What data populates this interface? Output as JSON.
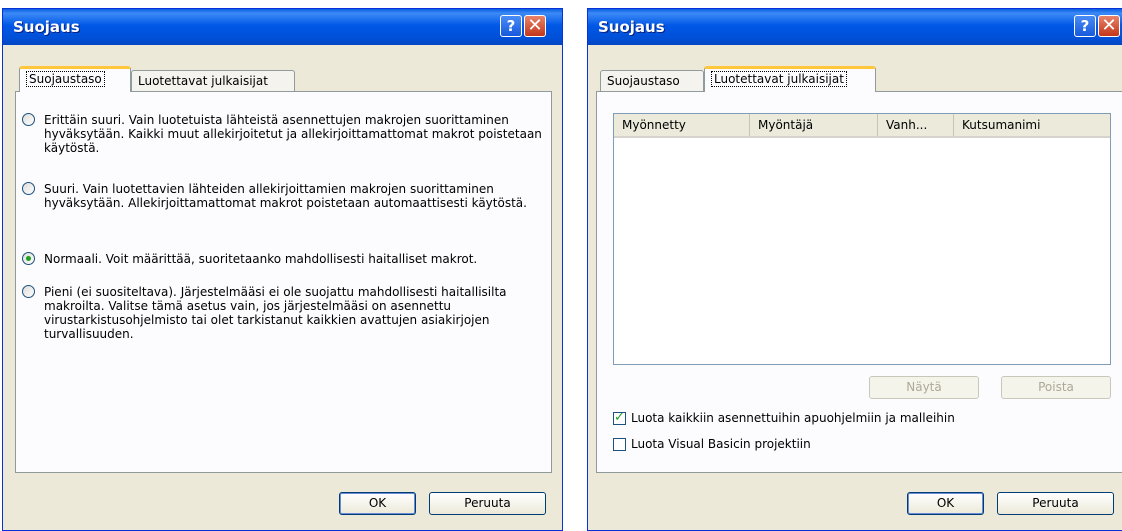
{
  "left_dialog": {
    "title": "Suojaus",
    "help_glyph": "?",
    "close_glyph": "✕",
    "tabs": [
      {
        "label": "Suojaustaso",
        "active": true
      },
      {
        "label": "Luotettavat julkaisijat",
        "active": false
      }
    ],
    "options": [
      {
        "label": "Erittäin suuri. Vain luotetuista lähteistä asennettujen makrojen suorittaminen hyväksytään. Kaikki muut allekirjoitetut ja allekirjoittamattomat makrot poistetaan käytöstä.",
        "checked": false
      },
      {
        "label": "Suuri. Vain luotettavien lähteiden allekirjoittamien makrojen suorittaminen hyväksytään. Allekirjoittamattomat makrot poistetaan automaattisesti käytöstä.",
        "checked": false
      },
      {
        "label": "Normaali. Voit määrittää, suoritetaanko mahdollisesti haitalliset makrot.",
        "checked": true
      },
      {
        "label": "Pieni (ei suositeltava). Järjestelmääsi ei ole suojattu mahdollisesti haitallisilta makroilta. Valitse tämä asetus vain, jos järjestelmääsi on asennettu virustarkistusohjelmisto tai olet tarkistanut kaikkien avattujen asiakirjojen turvallisuuden.",
        "checked": false
      }
    ],
    "ok_label": "OK",
    "cancel_label": "Peruuta"
  },
  "right_dialog": {
    "title": "Suojaus",
    "help_glyph": "?",
    "close_glyph": "✕",
    "tabs": [
      {
        "label": "Suojaustaso",
        "active": false
      },
      {
        "label": "Luotettavat julkaisijat",
        "active": true
      }
    ],
    "columns": [
      "Myönnetty",
      "Myöntäjä",
      "Vanh...",
      "Kutsumanimi"
    ],
    "view_label": "Näytä",
    "remove_label": "Poista",
    "checkboxes": [
      {
        "label": "Luota kaikkiin asennettuihin apuohjelmiin ja malleihin",
        "checked": true
      },
      {
        "label": "Luota Visual Basicin projektiin",
        "checked": false
      }
    ],
    "ok_label": "OK",
    "cancel_label": "Peruuta"
  },
  "colors": {
    "titlebar": "#0058e6",
    "dialog_bg": "#ece9d8",
    "tab_highlight": "#ffc83c",
    "radio_dot": "#21a121"
  }
}
